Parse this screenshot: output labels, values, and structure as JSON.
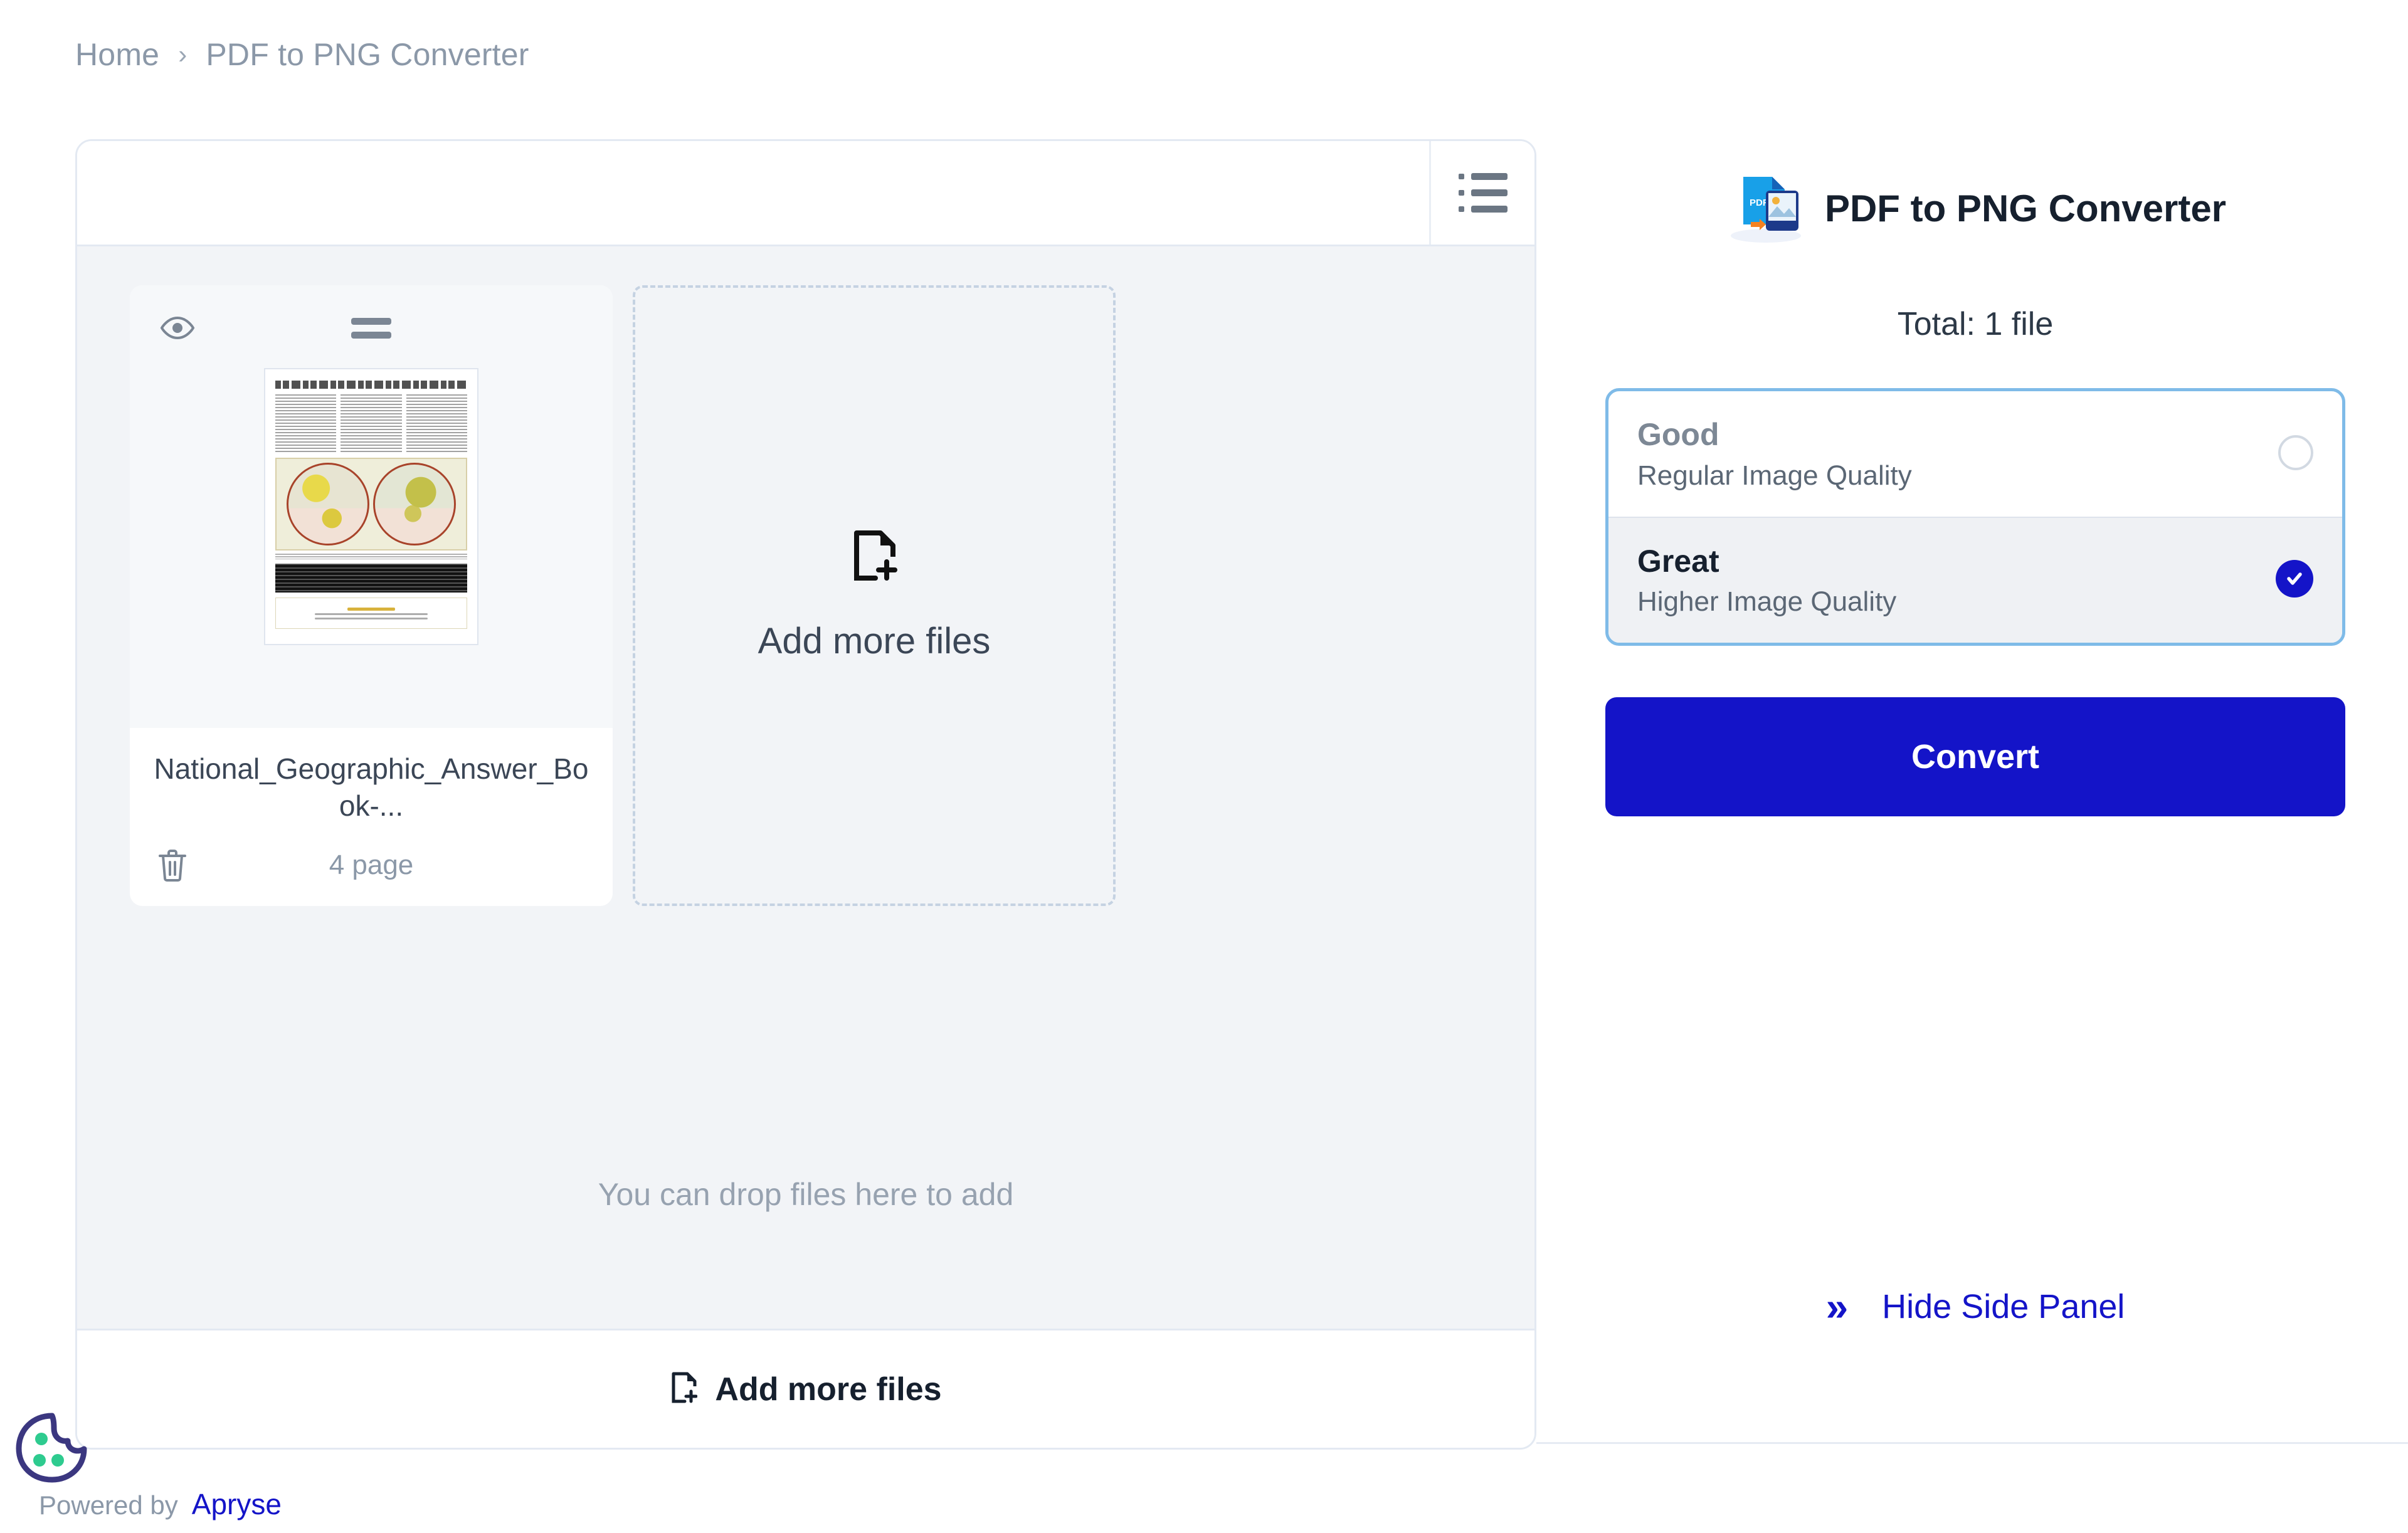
{
  "breadcrumb": {
    "home": "Home",
    "separator": "›",
    "current": "PDF to PNG Converter"
  },
  "toolbar": {
    "view_icon": "list-view-icon"
  },
  "files": {
    "items": [
      {
        "name": "National_Geographic_Answer_Book-...",
        "pages": "4 page",
        "preview_icon": "eye-icon",
        "drag_icon": "drag-handle-icon",
        "delete_icon": "trash-icon"
      }
    ],
    "dropzone": {
      "label": "Add more files",
      "icon": "file-plus-icon"
    },
    "drop_hint": "You can drop files here to add",
    "footer_action": {
      "label": "Add more files",
      "icon": "file-plus-icon"
    }
  },
  "side": {
    "logo_icon": "pdf-to-png-logo-icon",
    "title": "PDF to PNG Converter",
    "total": "Total: 1 file",
    "quality": {
      "options": [
        {
          "title": "Good",
          "subtitle": "Regular Image Quality",
          "selected": false
        },
        {
          "title": "Great",
          "subtitle": "Higher Image Quality",
          "selected": true
        }
      ]
    },
    "convert_label": "Convert",
    "hide_panel": {
      "label": "Hide Side Panel",
      "icon": "double-chevron-right-icon",
      "chevron": "»"
    }
  },
  "footer": {
    "powered_by": "Powered by",
    "brand": "Apryse",
    "cookie_icon": "cookie-icon"
  },
  "colors": {
    "accent_blue": "#1414c8",
    "panel_border": "#e3e9f2",
    "quality_border": "#7fbbe8",
    "muted_text": "#8b98a8",
    "dark_text": "#16202e",
    "body_bg": "#f2f4f7"
  }
}
